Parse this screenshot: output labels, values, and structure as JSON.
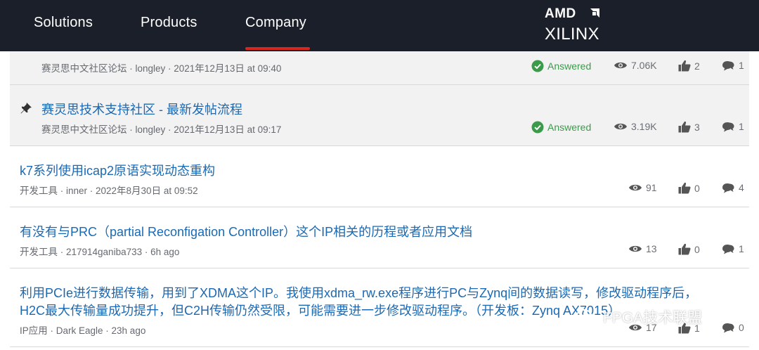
{
  "header": {
    "nav": [
      "Solutions",
      "Products",
      "Company"
    ],
    "logo_top": "AMD",
    "logo_bottom": "XILINX"
  },
  "posts": [
    {
      "title": "",
      "meta": "赛灵思中文社区论坛 · longley · 2021年12月13日 at 09:40",
      "answered": "Answered",
      "views": "7.06K",
      "likes": "2",
      "replies": "1",
      "pinned": true
    },
    {
      "title": "赛灵思技术支持社区 - 最新发帖流程",
      "meta": "赛灵思中文社区论坛 · longley · 2021年12月13日 at 09:17",
      "answered": "Answered",
      "views": "3.19K",
      "likes": "3",
      "replies": "1",
      "pinned": true
    },
    {
      "title": "k7系列使用icap2原语实现动态重构",
      "meta": "开发工具 · inner · 2022年8月30日 at 09:52",
      "views": "91",
      "likes": "0",
      "replies": "4"
    },
    {
      "title": "有没有与PRC（partial Reconfigation Controller）这个IP相关的历程或者应用文档",
      "meta": "开发工具 · 217914ganiba733 · 6h ago",
      "views": "13",
      "likes": "0",
      "replies": "1"
    },
    {
      "title_line1": "利用PCIe进行数据传输，用到了XDMA这个IP。我使用xdma_rw.exe程序进行PC与Zynq间的数据读写，修改驱动程序后，",
      "title_line2": "H2C最大传输量成功提升，但C2H传输仍然受限，可能需要进一步修改驱动程序。（开发板：Zynq AX7015）",
      "meta": "IP应用 · Dark Eagle · 23h ago",
      "views": "17",
      "likes": "1",
      "replies": "0"
    }
  ],
  "watermark": "FPGA技术联盟",
  "colors": {
    "header_bg": "#1b1f2a",
    "accent_underline": "#d7261e",
    "link": "#1c69b3",
    "answered": "#3c9a4b",
    "pinned_bg": "#f2f2f2"
  }
}
